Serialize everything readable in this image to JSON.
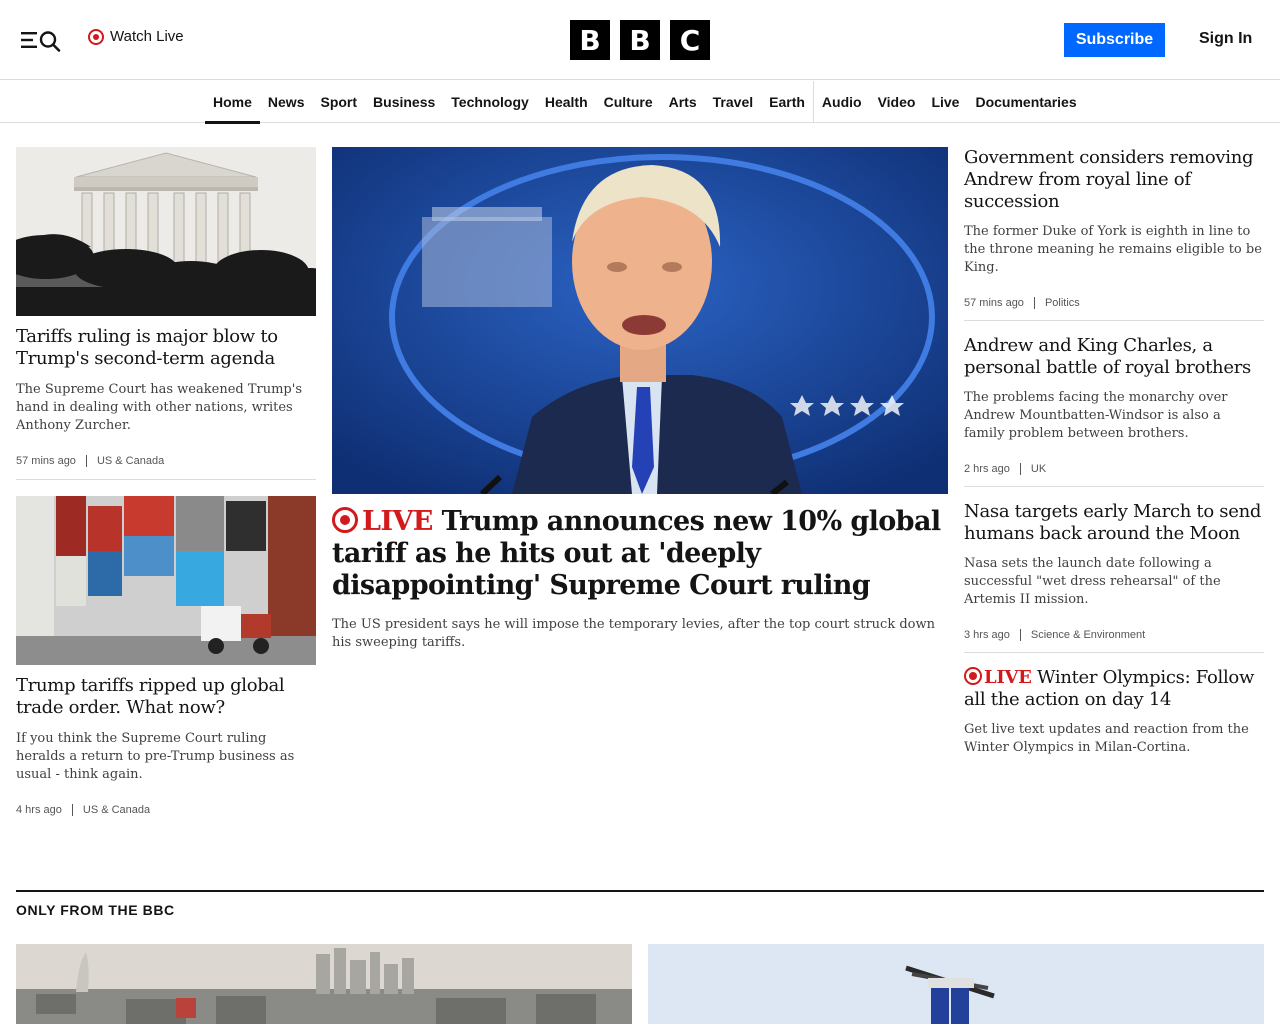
{
  "header": {
    "watch_live": "Watch Live",
    "logo_letters": [
      "B",
      "B",
      "C"
    ],
    "subscribe": "Subscribe",
    "sign_in": "Sign In",
    "accent_color": "#0068ff",
    "live_color": "#d2191b"
  },
  "nav": {
    "items": [
      "Home",
      "News",
      "Sport",
      "Business",
      "Technology",
      "Health",
      "Culture",
      "Arts",
      "Travel",
      "Earth",
      "Audio",
      "Video",
      "Live",
      "Documentaries"
    ],
    "active": "Home"
  },
  "left": {
    "articles": [
      {
        "headline": "Tariffs ruling is major blow to Trump's second-term agenda",
        "summary": "The Supreme Court has weakened Trump's hand in dealing with other nations, writes Anthony Zurcher.",
        "time": "57 mins ago",
        "category": "US & Canada"
      },
      {
        "headline": "Trump tariffs ripped up global trade order. What now?",
        "summary": "If you think the Supreme Court ruling heralds a return to pre-Trump business as usual - think again.",
        "time": "4 hrs ago",
        "category": "US & Canada"
      }
    ]
  },
  "center": {
    "live_label": "LIVE",
    "headline": "Trump announces new 10% global tariff as he hits out at 'deeply disappointing' Supreme Court ruling",
    "summary": "The US president says he will impose the temporary levies, after the top court struck down his sweeping tariffs."
  },
  "right": {
    "articles": [
      {
        "headline": "Government considers removing Andrew from royal line of succession",
        "summary": "The former Duke of York is eighth in line to the throne meaning he remains eligible to be King.",
        "time": "57 mins ago",
        "category": "Politics"
      },
      {
        "headline": "Andrew and King Charles, a personal battle of royal brothers",
        "summary": "The problems facing the monarchy over Andrew Mountbatten-Windsor is also a family problem between brothers.",
        "time": "2 hrs ago",
        "category": "UK"
      },
      {
        "headline": "Nasa targets early March to send humans back around the Moon",
        "summary": "Nasa sets the launch date following a successful \"wet dress rehearsal\" of the Artemis II mission.",
        "time": "3 hrs ago",
        "category": "Science & Environment"
      }
    ],
    "live_article": {
      "live_label": "LIVE",
      "headline": "Winter Olympics: Follow all the action on day 14",
      "summary": "Get live text updates and reaction from the Winter Olympics in Milan-Cortina."
    }
  },
  "section": {
    "title": "ONLY FROM THE BBC"
  }
}
